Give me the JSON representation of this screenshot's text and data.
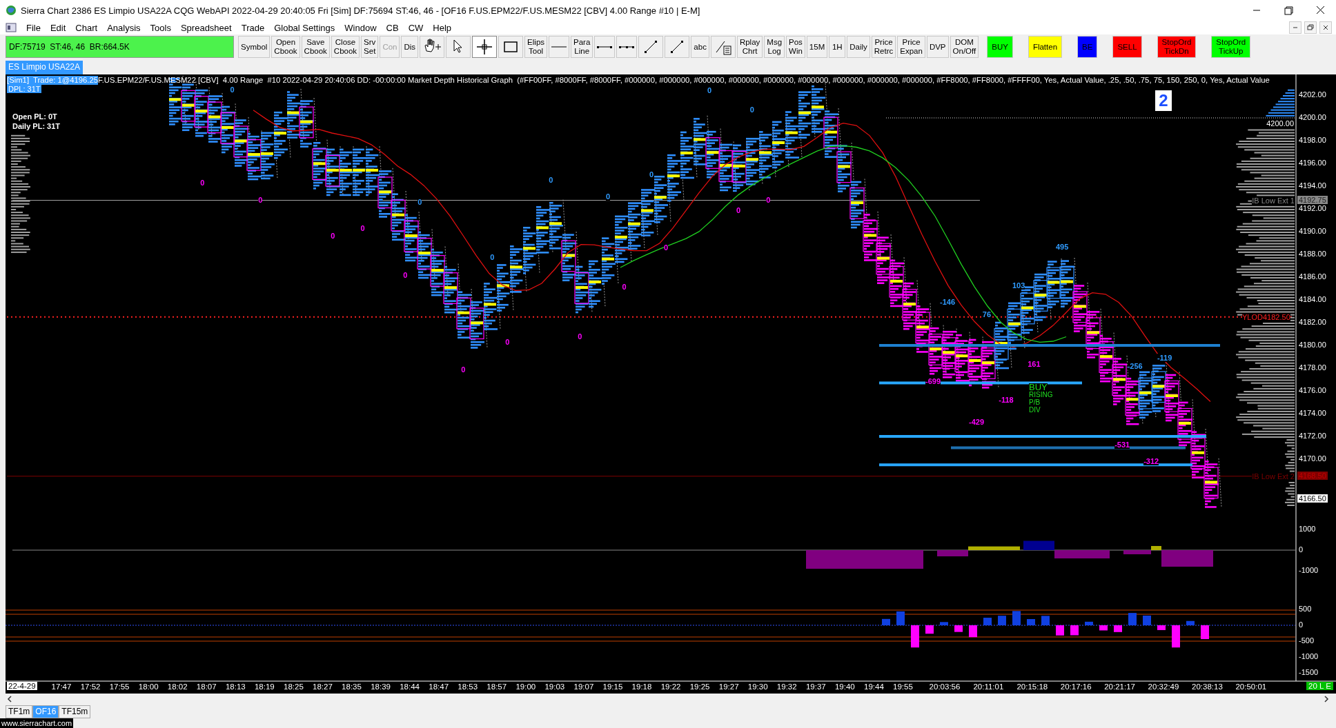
{
  "window": {
    "title": "Sierra Chart 2386 ES Limpio USA22A  CQG WebAPI 2022-04-29  20:40:05 Fri [Sim]  DF:75694  ST:46, 46 - [OF16 F.US.EPM22/F.US.MESM22 [CBV]  4.00 Range  #10 | E-M]"
  },
  "menu": [
    {
      "label": "File"
    },
    {
      "label": "Edit"
    },
    {
      "label": "Chart"
    },
    {
      "label": "Analysis"
    },
    {
      "label": "Tools"
    },
    {
      "label": "Spreadsheet"
    },
    {
      "label": "Trade"
    },
    {
      "label": "Global Settings"
    },
    {
      "label": "Window"
    },
    {
      "label": "CB"
    },
    {
      "label": "CW"
    },
    {
      "label": "Help"
    }
  ],
  "status_field": "DF:75719  ST:46, 46  BR:664.5K",
  "toolbar": [
    {
      "kind": "text",
      "lines": [
        "Symbol"
      ],
      "disabled": false
    },
    {
      "kind": "text",
      "lines": [
        "Open",
        "Cbook"
      ],
      "disabled": false
    },
    {
      "kind": "text",
      "lines": [
        "Save",
        "Cbook"
      ],
      "disabled": false
    },
    {
      "kind": "text",
      "lines": [
        "Close",
        "Cbook"
      ],
      "disabled": false
    },
    {
      "kind": "text",
      "lines": [
        "Srv",
        "Set"
      ],
      "disabled": false
    },
    {
      "kind": "text",
      "lines": [
        "Con"
      ],
      "disabled": true
    },
    {
      "kind": "text",
      "lines": [
        "Dis"
      ],
      "disabled": false
    },
    {
      "kind": "hand",
      "selected": false
    },
    {
      "kind": "pointer",
      "selected": false
    },
    {
      "kind": "crosshair",
      "selected": true
    },
    {
      "kind": "rect",
      "selected": false
    },
    {
      "kind": "text",
      "lines": [
        "Elips",
        "Tool"
      ],
      "disabled": false
    },
    {
      "kind": "hline",
      "selected": false
    },
    {
      "kind": "text",
      "lines": [
        "Para",
        "Line"
      ],
      "disabled": false
    },
    {
      "kind": "segment",
      "selected": false
    },
    {
      "kind": "dotsegment",
      "selected": false
    },
    {
      "kind": "ray",
      "selected": false
    },
    {
      "kind": "ray",
      "selected": false
    },
    {
      "kind": "text",
      "lines": [
        "abc"
      ],
      "disabled": false
    },
    {
      "kind": "calc",
      "selected": false
    },
    {
      "kind": "text",
      "lines": [
        "Rplay",
        "Chrt"
      ],
      "disabled": false
    },
    {
      "kind": "text",
      "lines": [
        "Msg",
        "Log"
      ],
      "disabled": false
    },
    {
      "kind": "text",
      "lines": [
        "Pos",
        "Win"
      ],
      "disabled": false
    },
    {
      "kind": "text",
      "lines": [
        "15M"
      ],
      "disabled": false
    },
    {
      "kind": "text",
      "lines": [
        "1H"
      ],
      "disabled": false
    },
    {
      "kind": "text",
      "lines": [
        "Daily"
      ],
      "disabled": false
    },
    {
      "kind": "text",
      "lines": [
        "Price",
        "Retrc"
      ],
      "disabled": false
    },
    {
      "kind": "text",
      "lines": [
        "Price",
        "Expan"
      ],
      "disabled": false
    },
    {
      "kind": "text",
      "lines": [
        "DVP"
      ],
      "disabled": false
    },
    {
      "kind": "text",
      "lines": [
        "DOM",
        "On/Off"
      ],
      "disabled": false
    },
    {
      "kind": "color",
      "lines": [
        "BUY"
      ],
      "color": "#00ff00"
    },
    {
      "kind": "color",
      "lines": [
        "Flatten"
      ],
      "color": "#ffff00"
    },
    {
      "kind": "color",
      "lines": [
        "BE"
      ],
      "color": "#0000ff"
    },
    {
      "kind": "color",
      "lines": [
        "SELL"
      ],
      "color": "#ff0000"
    },
    {
      "kind": "color",
      "lines": [
        "StopOrd",
        "TickDn"
      ],
      "color": "#ff0000"
    },
    {
      "kind": "color",
      "lines": [
        "StopOrd",
        "TickUp"
      ],
      "color": "#00ff00"
    }
  ],
  "chart_tab": "ES Limpio USA22A",
  "chart": {
    "header_tag": "[Sim1]  Trade: 1@4196.25",
    "header_text": "F.US.EPM22/F.US.MESM22 [CBV]  4.00 Range  #10 2022-04-29 20:40:06 DD: -00:00:00 Market Depth Historical Graph  (#FF00FF, #8000FF, #8000FF, #000000, #000000, #000000, #000000, #000000, #000000, #000000, #000000, #000000, #FF8000, #FF8000, #FFFF00, Yes, Actual Value, .25, .50, .75, 75, 150, 250, 0, Yes, Actual Value",
    "dpl": "DPL: 31T",
    "open_pl": "Open PL: 0T",
    "daily_pl": "Daily PL: 31T",
    "position_badge": "2",
    "level_labels": [
      {
        "kind": "plain",
        "text": "4200.00"
      },
      {
        "kind": "ib1",
        "text": "IB Low Ext 1"
      },
      {
        "kind": "ylod",
        "text": "YLOD"
      },
      {
        "kind": "ylodval",
        "text": "4182.50"
      },
      {
        "kind": "ib2",
        "text": "IB Low Ext 2"
      }
    ],
    "delta_labels": [
      {
        "text": "0",
        "color": "#2f9bff"
      },
      {
        "text": "0",
        "color": "#2f9bff"
      },
      {
        "text": "0",
        "color": "#2f9bff"
      },
      {
        "text": "0",
        "color": "#2f9bff"
      },
      {
        "text": "0",
        "color": "#2f9bff"
      },
      {
        "text": "0",
        "color": "#2f9bff"
      },
      {
        "text": "0",
        "color": "#2f9bff"
      },
      {
        "text": "0",
        "color": "#2f9bff"
      },
      {
        "text": "0",
        "color": "#ff00ff"
      },
      {
        "text": "0",
        "color": "#ff00ff"
      },
      {
        "text": "0",
        "color": "#ff00ff"
      },
      {
        "text": "0",
        "color": "#ff00ff"
      },
      {
        "text": "0",
        "color": "#ff00ff"
      },
      {
        "text": "0",
        "color": "#ff00ff"
      },
      {
        "text": "0",
        "color": "#ff00ff"
      },
      {
        "text": "0",
        "color": "#ff00ff"
      },
      {
        "text": "0",
        "color": "#ff00ff"
      },
      {
        "text": "0",
        "color": "#ff00ff"
      },
      {
        "text": "0",
        "color": "#ff00ff"
      },
      {
        "text": "0",
        "color": "#ff00ff"
      },
      {
        "text": "-146",
        "color": "#2f9bff"
      },
      {
        "text": "76",
        "color": "#2f9bff"
      },
      {
        "text": "103",
        "color": "#2f9bff"
      },
      {
        "text": "495",
        "color": "#2f9bff"
      },
      {
        "text": "-699",
        "color": "#ff00ff"
      },
      {
        "text": "-118",
        "color": "#ff00ff"
      },
      {
        "text": "-429",
        "color": "#ff00ff"
      },
      {
        "text": "161",
        "color": "#ff00ff"
      },
      {
        "text": "-256",
        "color": "#2f9bff"
      },
      {
        "text": "-119",
        "color": "#2f9bff"
      },
      {
        "text": "-531",
        "color": "#ff00ff"
      },
      {
        "text": "-312",
        "color": "#ff00ff"
      }
    ],
    "signal_lines": [
      "BUY",
      "RISING",
      "P/B",
      "DIV"
    ],
    "price_axis": [
      "4202.00",
      "4200.00",
      "4198.00",
      "4196.00",
      "4194.00",
      "4192.00",
      "4190.00",
      "4188.00",
      "4186.00",
      "4184.00",
      "4182.00",
      "4180.00",
      "4178.00",
      "4176.00",
      "4174.00",
      "4172.00",
      "4170.00"
    ],
    "price_markers": [
      {
        "kind": "ib1",
        "text": "4192.75"
      },
      {
        "kind": "ib2",
        "text": "4168.50"
      },
      {
        "kind": "last",
        "text": "4166.50"
      }
    ],
    "pane1_axis": [
      "1000",
      "0",
      "-1000"
    ],
    "pane2_axis": [
      "500",
      "0",
      "-500",
      "-1000",
      "-1500"
    ],
    "time_start": "22-4-29",
    "time_axis": [
      "17:47",
      "17:52",
      "17:55",
      "18:00",
      "18:02",
      "18:07",
      "18:13",
      "18:19",
      "18:25",
      "18:27",
      "18:35",
      "18:39",
      "18:44",
      "18:47",
      "18:53",
      "18:57",
      "19:00",
      "19:03",
      "19:07",
      "19:15",
      "19:18",
      "19:22",
      "19:25",
      "19:27",
      "19:30",
      "19:32",
      "19:37",
      "19:40",
      "19:44",
      "19:55",
      "20:03:56",
      "20:11:01",
      "20:15:18",
      "20:17:16",
      "20:21:17",
      "20:32:49",
      "20:38:13",
      "20:50:01"
    ],
    "trade_mode": "20 L E"
  },
  "sheet_tabs": [
    {
      "label": "TF1m",
      "selected": false
    },
    {
      "label": "OF16",
      "selected": true
    },
    {
      "label": "TF15m",
      "selected": false
    }
  ],
  "footer_link": "www.sierrachart.com"
}
